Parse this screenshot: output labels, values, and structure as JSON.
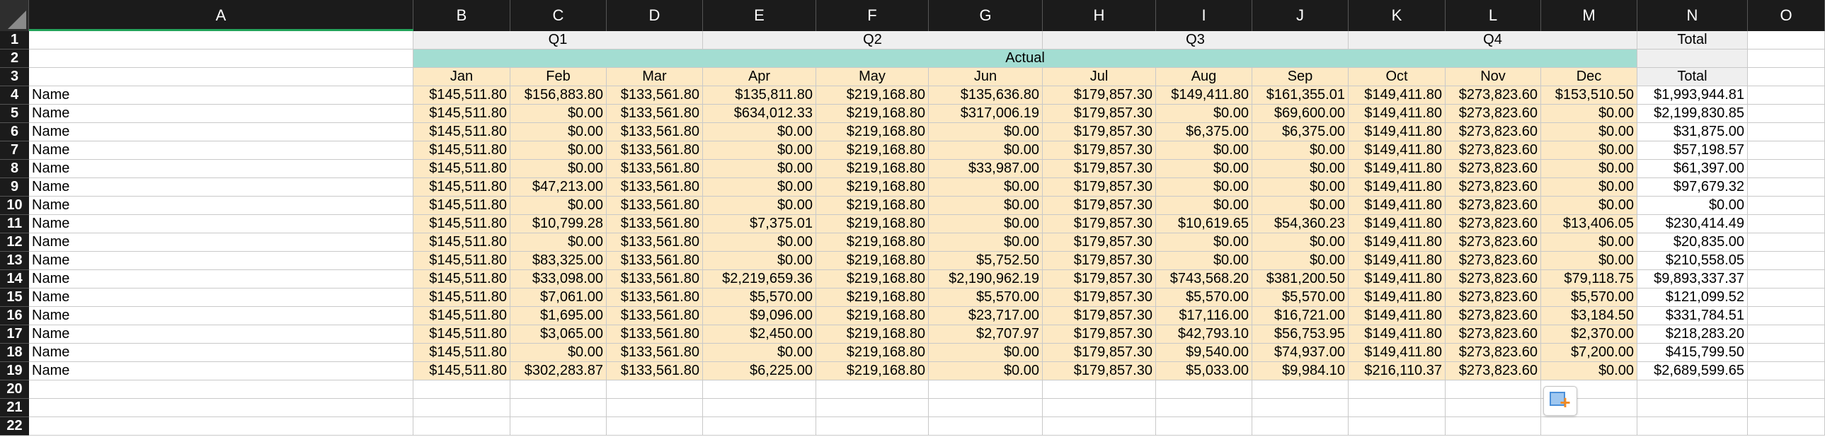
{
  "columns": [
    "A",
    "B",
    "C",
    "D",
    "E",
    "F",
    "G",
    "H",
    "I",
    "J",
    "K",
    "L",
    "M",
    "N",
    "O"
  ],
  "row_numbers": [
    "1",
    "2",
    "3",
    "4",
    "5",
    "6",
    "7",
    "8",
    "9",
    "10",
    "11",
    "12",
    "13",
    "14",
    "15",
    "16",
    "17",
    "18",
    "19",
    "20",
    "21",
    "22"
  ],
  "quarters": [
    "Q1",
    "Q2",
    "Q3",
    "Q4"
  ],
  "total_label": "Total",
  "actual_label": "Actual",
  "months": [
    "Jan",
    "Feb",
    "Mar",
    "Apr",
    "May",
    "Jun",
    "Jul",
    "Aug",
    "Sep",
    "Oct",
    "Nov",
    "Dec"
  ],
  "rows": [
    {
      "name": "Name",
      "values": [
        "$145,511.80",
        "$156,883.80",
        "$133,561.80",
        "$135,811.80",
        "$219,168.80",
        "$135,636.80",
        "$179,857.30",
        "$149,411.80",
        "$161,355.01",
        "$149,411.80",
        "$273,823.60",
        "$153,510.50"
      ],
      "total": "$1,993,944.81"
    },
    {
      "name": "Name",
      "values": [
        "$145,511.80",
        "$0.00",
        "$133,561.80",
        "$634,012.33",
        "$219,168.80",
        "$317,006.19",
        "$179,857.30",
        "$0.00",
        "$69,600.00",
        "$149,411.80",
        "$273,823.60",
        "$0.00"
      ],
      "total": "$2,199,830.85"
    },
    {
      "name": "Name",
      "values": [
        "$145,511.80",
        "$0.00",
        "$133,561.80",
        "$0.00",
        "$219,168.80",
        "$0.00",
        "$179,857.30",
        "$6,375.00",
        "$6,375.00",
        "$149,411.80",
        "$273,823.60",
        "$0.00"
      ],
      "total": "$31,875.00"
    },
    {
      "name": "Name",
      "values": [
        "$145,511.80",
        "$0.00",
        "$133,561.80",
        "$0.00",
        "$219,168.80",
        "$0.00",
        "$179,857.30",
        "$0.00",
        "$0.00",
        "$149,411.80",
        "$273,823.60",
        "$0.00"
      ],
      "total": "$57,198.57"
    },
    {
      "name": "Name",
      "values": [
        "$145,511.80",
        "$0.00",
        "$133,561.80",
        "$0.00",
        "$219,168.80",
        "$33,987.00",
        "$179,857.30",
        "$0.00",
        "$0.00",
        "$149,411.80",
        "$273,823.60",
        "$0.00"
      ],
      "total": "$61,397.00"
    },
    {
      "name": "Name",
      "values": [
        "$145,511.80",
        "$47,213.00",
        "$133,561.80",
        "$0.00",
        "$219,168.80",
        "$0.00",
        "$179,857.30",
        "$0.00",
        "$0.00",
        "$149,411.80",
        "$273,823.60",
        "$0.00"
      ],
      "total": "$97,679.32"
    },
    {
      "name": "Name",
      "values": [
        "$145,511.80",
        "$0.00",
        "$133,561.80",
        "$0.00",
        "$219,168.80",
        "$0.00",
        "$179,857.30",
        "$0.00",
        "$0.00",
        "$149,411.80",
        "$273,823.60",
        "$0.00"
      ],
      "total": "$0.00"
    },
    {
      "name": "Name",
      "values": [
        "$145,511.80",
        "$10,799.28",
        "$133,561.80",
        "$7,375.01",
        "$219,168.80",
        "$0.00",
        "$179,857.30",
        "$10,619.65",
        "$54,360.23",
        "$149,411.80",
        "$273,823.60",
        "$13,406.05"
      ],
      "total": "$230,414.49"
    },
    {
      "name": "Name",
      "values": [
        "$145,511.80",
        "$0.00",
        "$133,561.80",
        "$0.00",
        "$219,168.80",
        "$0.00",
        "$179,857.30",
        "$0.00",
        "$0.00",
        "$149,411.80",
        "$273,823.60",
        "$0.00"
      ],
      "total": "$20,835.00"
    },
    {
      "name": "Name",
      "values": [
        "$145,511.80",
        "$83,325.00",
        "$133,561.80",
        "$0.00",
        "$219,168.80",
        "$5,752.50",
        "$179,857.30",
        "$0.00",
        "$0.00",
        "$149,411.80",
        "$273,823.60",
        "$0.00"
      ],
      "total": "$210,558.05"
    },
    {
      "name": "Name",
      "values": [
        "$145,511.80",
        "$33,098.00",
        "$133,561.80",
        "$2,219,659.36",
        "$219,168.80",
        "$2,190,962.19",
        "$179,857.30",
        "$743,568.20",
        "$381,200.50",
        "$149,411.80",
        "$273,823.60",
        "$79,118.75"
      ],
      "total": "$9,893,337.37"
    },
    {
      "name": "Name",
      "values": [
        "$145,511.80",
        "$7,061.00",
        "$133,561.80",
        "$5,570.00",
        "$219,168.80",
        "$5,570.00",
        "$179,857.30",
        "$5,570.00",
        "$5,570.00",
        "$149,411.80",
        "$273,823.60",
        "$5,570.00"
      ],
      "total": "$121,099.52"
    },
    {
      "name": "Name",
      "values": [
        "$145,511.80",
        "$1,695.00",
        "$133,561.80",
        "$9,096.00",
        "$219,168.80",
        "$23,717.00",
        "$179,857.30",
        "$17,116.00",
        "$16,721.00",
        "$149,411.80",
        "$273,823.60",
        "$3,184.50"
      ],
      "total": "$331,784.51"
    },
    {
      "name": "Name",
      "values": [
        "$145,511.80",
        "$3,065.00",
        "$133,561.80",
        "$2,450.00",
        "$219,168.80",
        "$2,707.97",
        "$179,857.30",
        "$42,793.10",
        "$56,753.95",
        "$149,411.80",
        "$273,823.60",
        "$2,370.00"
      ],
      "total": "$218,283.20"
    },
    {
      "name": "Name",
      "values": [
        "$145,511.80",
        "$0.00",
        "$133,561.80",
        "$0.00",
        "$219,168.80",
        "$0.00",
        "$179,857.30",
        "$9,540.00",
        "$74,937.00",
        "$149,411.80",
        "$273,823.60",
        "$7,200.00"
      ],
      "total": "$415,799.50"
    },
    {
      "name": "Name",
      "values": [
        "$145,511.80",
        "$302,283.87",
        "$133,561.80",
        "$6,225.00",
        "$219,168.80",
        "$0.00",
        "$179,857.30",
        "$5,033.00",
        "$9,984.10",
        "$216,110.37",
        "$273,823.60",
        "$0.00"
      ],
      "total": "$2,689,599.65"
    }
  ],
  "colors": {
    "header_bg": "#1b1b1b",
    "month_bg": "#fde9c4",
    "actual_bg": "#a3ddd2",
    "quarter_bg": "#efefef",
    "selection": "#23a35a"
  },
  "quick_analysis_icon": "quick-analysis-icon"
}
